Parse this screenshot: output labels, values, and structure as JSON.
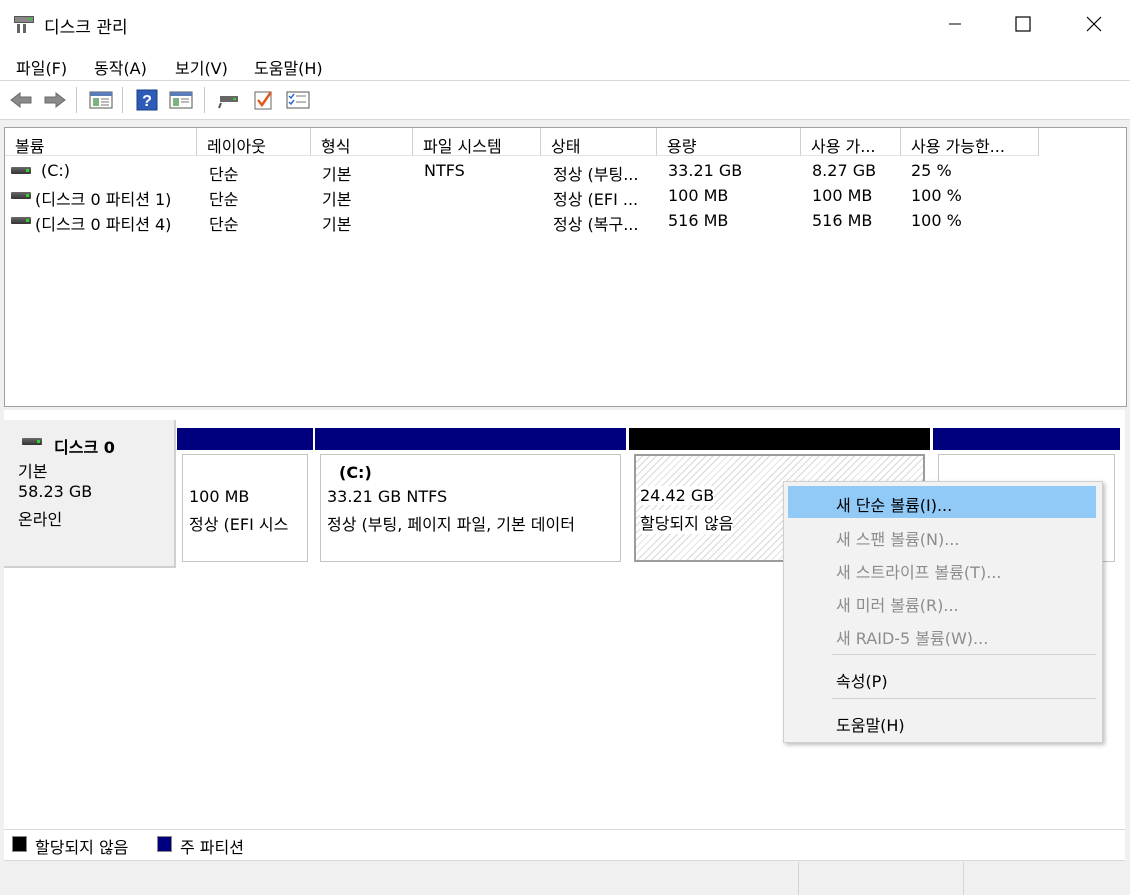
{
  "window": {
    "title": "디스크 관리",
    "app_icon": "disk-management-icon"
  },
  "menu": [
    "파일(F)",
    "동작(A)",
    "보기(V)",
    "도움말(H)"
  ],
  "toolbar": {
    "buttons": [
      "back-icon",
      "forward-icon",
      "show-pane-icon",
      "help-icon",
      "show-hide-action-pane-icon",
      "connect-disk-icon",
      "check-properties-icon",
      "list-properties-icon"
    ]
  },
  "volume_list": {
    "columns": [
      "볼륨",
      "레이아웃",
      "형식",
      "파일 시스템",
      "상태",
      "용량",
      "사용 가...",
      "사용 가능한..."
    ],
    "rows": [
      [
        "(C:)",
        "단순",
        "기본",
        "NTFS",
        "정상 (부팅...",
        "33.21 GB",
        "8.27 GB",
        "25 %"
      ],
      [
        "(디스크 0 파티션 1)",
        "단순",
        "기본",
        "",
        "정상 (EFI ...",
        "100 MB",
        "100 MB",
        "100 %"
      ],
      [
        "(디스크 0 파티션 4)",
        "단순",
        "기본",
        "",
        "정상 (복구...",
        "516 MB",
        "516 MB",
        "100 %"
      ]
    ]
  },
  "disk": {
    "name": "디스크 0",
    "type": "기본",
    "size": "58.23 GB",
    "status": "온라인",
    "partitions": [
      {
        "title": "",
        "size": "100 MB",
        "status": "정상 (EFI 시스"
      },
      {
        "title": "(C:)",
        "size": "33.21 GB NTFS",
        "status": "정상 (부팅, 페이지 파일, 기본 데이터"
      },
      {
        "title": "",
        "size": "24.42 GB",
        "status": "할당되지 않음"
      },
      {
        "title": "",
        "size": "",
        "status": ""
      }
    ]
  },
  "legend": [
    {
      "label": "할당되지 않음",
      "color": "#000000"
    },
    {
      "label": "주 파티션",
      "color": "#00007f"
    }
  ],
  "colors": {
    "primary_partition": "#00007f",
    "unallocated": "#000000",
    "menu_highlight": "#91c9f7"
  },
  "context_menu": {
    "items": [
      {
        "label": "새 단순 볼륨(I)...",
        "enabled": true,
        "highlighted": true
      },
      {
        "label": "새 스팬 볼륨(N)...",
        "enabled": false
      },
      {
        "label": "새 스트라이프 볼륨(T)...",
        "enabled": false
      },
      {
        "label": "새 미러 볼륨(R)...",
        "enabled": false
      },
      {
        "label": "새 RAID-5 볼륨(W)...",
        "enabled": false
      },
      {
        "label": "속성(P)",
        "enabled": true
      },
      {
        "label": "도움말(H)",
        "enabled": true
      }
    ]
  }
}
